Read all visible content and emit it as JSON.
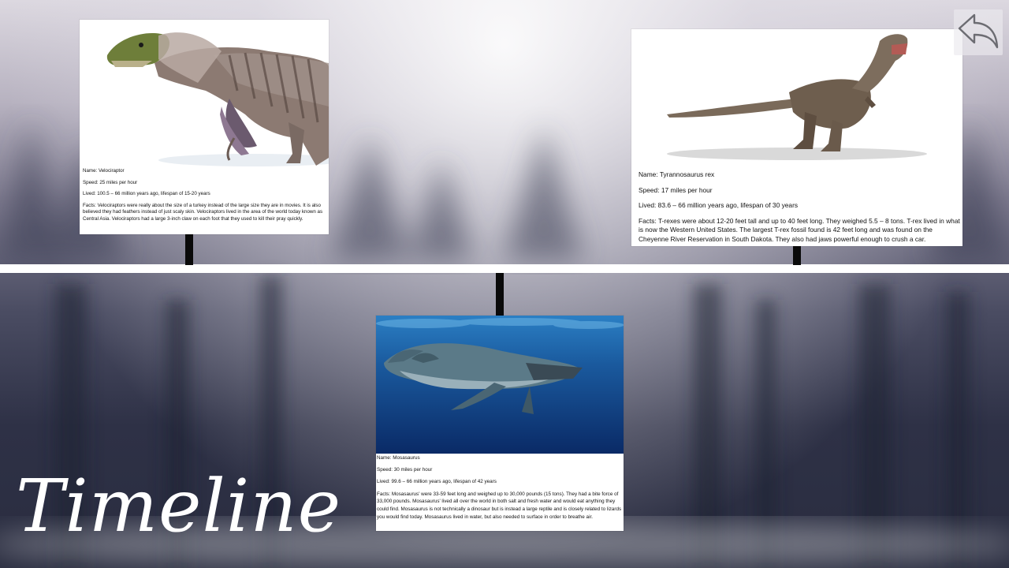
{
  "title": "Timeline",
  "back_button": {
    "icon": "back-arrow-icon",
    "label": ""
  },
  "cards": [
    {
      "id": "velociraptor",
      "image_name": "velociraptor-image",
      "name": "Name: Velociraptor",
      "speed": "Speed: 25 miles per hour",
      "lived": "Lived: 100.5 – 66 million years ago, lifespan of 15-20 years",
      "facts": "Facts: Velociraptors were really about the size of a turkey instead of the large size they are in movies. It is also believed they had feathers instead of just scaly skin. Velociraptors lived in the area of the world today known as Central Asia. Velociraptors had a large 3-inch claw on each foot that they used to kill their pray quickly."
    },
    {
      "id": "trex",
      "image_name": "tyrannosaurus-image",
      "name": "Name: Tyrannosaurus rex",
      "speed": "Speed: 17 miles per hour",
      "lived": "Lived: 83.6 – 66 million years ago, lifespan of 30 years",
      "facts": "Facts: T-rexes were about 12-20 feet tall and up to 40 feet long. They weighed 5.5 – 8 tons. T-rex lived in what is now the Western United States. The largest T-rex fossil found is 42 feet long and was found on the Cheyenne River Reservation in South Dakota. They also had jaws powerful enough to crush a car."
    },
    {
      "id": "mosasaurus",
      "image_name": "mosasaurus-image",
      "name": "Name: Mosasaurus",
      "speed": "Speed: 30 miles per hour",
      "lived": "Lived: 99.6 – 66 million years ago, lifespan of 42 years",
      "facts": "Facts: Mosasaurus' were 33-59 feet long and weighed up to 30,000 pounds (15 tons). They had a bite force of 33,000 pounds. Mosasaurus' lived all over the world in both salt and fresh water and would eat anything they could find. Mosasaurus is not technically a dinosaur but is instead a large reptile and is closely related to lizards you would find today. Mosasaurus lived in water, but also needed to surface in order to breathe air."
    }
  ]
}
